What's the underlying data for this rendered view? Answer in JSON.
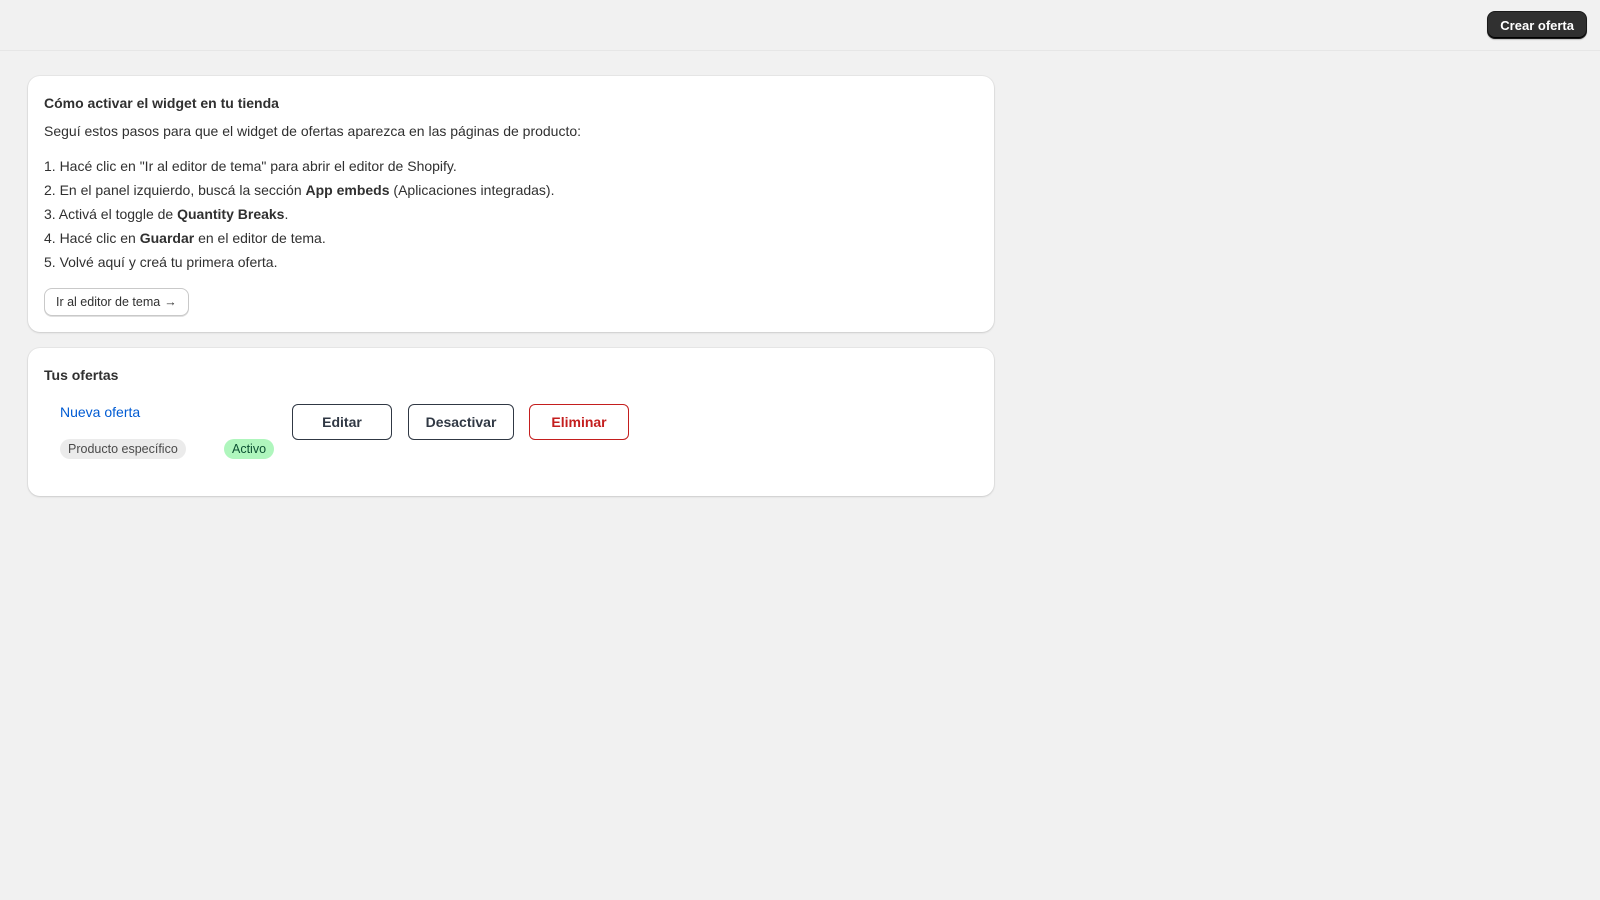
{
  "header": {
    "create_offer_label": "Crear oferta"
  },
  "help_card": {
    "title": "Cómo activar el widget en tu tienda",
    "intro": "Seguí estos pasos para que el widget de ofertas aparezca en las páginas de producto:",
    "steps": [
      {
        "before": "1. Hacé clic en \"Ir al editor de tema\" para abrir el editor de Shopify.",
        "bold": "",
        "after": ""
      },
      {
        "before": "2. En el panel izquierdo, buscá la sección ",
        "bold": "App embeds",
        "after": " (Aplicaciones integradas)."
      },
      {
        "before": "3. Activá el toggle de ",
        "bold": "Quantity Breaks",
        "after": "."
      },
      {
        "before": "4. Hacé clic en ",
        "bold": "Guardar",
        "after": " en el editor de tema."
      },
      {
        "before": "5. Volvé aquí y creá tu primera oferta.",
        "bold": "",
        "after": ""
      }
    ],
    "theme_editor_label": "Ir al editor de tema",
    "theme_editor_arrow": "→"
  },
  "offers_card": {
    "title": "Tus ofertas",
    "offers": [
      {
        "name": "Nueva oferta",
        "type_badge": "Producto específico",
        "status_badge": "Activo",
        "edit_label": "Editar",
        "deactivate_label": "Desactivar",
        "delete_label": "Eliminar"
      }
    ]
  },
  "colors": {
    "background": "#f1f1f1",
    "primary_button": "#303030",
    "link": "#005bd3",
    "danger": "#c41e1e",
    "success_badge": "#aff6bd"
  }
}
